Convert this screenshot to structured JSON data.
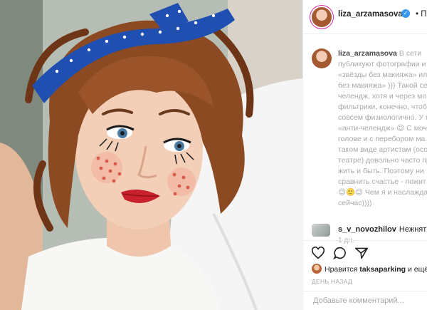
{
  "header": {
    "username": "liza_arzamasova",
    "follow_label": "Подп",
    "verified_icon": "✓"
  },
  "caption": {
    "lines": [
      {
        "bold": "liza_arzamasova",
        "text": "В сети"
      },
      {
        "bold": "",
        "text": "публикуют фотографии и"
      },
      {
        "bold": "",
        "text": "«звёзды без макияжа» ил"
      },
      {
        "bold": "",
        "text": "без макияжа» ))) Такой се"
      },
      {
        "bold": "",
        "text": "челендж, хотя и через мо"
      },
      {
        "bold": "",
        "text": "фильтрики, конечно, чтоб"
      },
      {
        "bold": "",
        "text": "совсем физиологично. У м"
      },
      {
        "bold": "",
        "text": "«анти-челендж» 😉 С моч"
      },
      {
        "bold": "",
        "text": "голове и с перебором ма"
      },
      {
        "bold": "",
        "text": "таком виде артистам (осо"
      },
      {
        "bold": "",
        "text": "театре) довольно часто пр"
      },
      {
        "bold": "",
        "text": "жить и быть. Поэтому ни"
      },
      {
        "bold": "",
        "text": "сравнить счастье - пожит"
      },
      {
        "bold": "",
        "text": "😊🙂😊 Чем я и наслажда"
      },
      {
        "bold": "",
        "text": "сейчас))))"
      }
    ],
    "time": "1 дн."
  },
  "comment": {
    "username": "s_v_novozhilov",
    "text": "Нежнятин"
  },
  "likes": {
    "prefix": "Нравится",
    "user": "taksaparking",
    "suffix": "и ещё"
  },
  "ago": "день назад",
  "add_comment": {
    "placeholder": "Добавьте комментарий...",
    "value": ""
  },
  "colors": {
    "accent": "#3897f0",
    "text": "#262626",
    "muted": "#a8a8a8",
    "border": "#efefef"
  }
}
